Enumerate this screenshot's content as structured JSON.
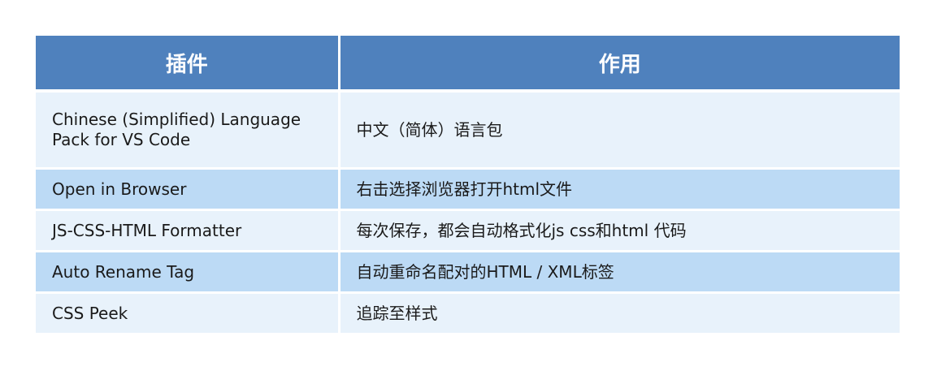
{
  "table": {
    "headers": [
      "插件",
      "作用"
    ],
    "rows": [
      {
        "plugin": "Chinese (Simplified) Language Pack for VS Code",
        "purpose": "中文（简体）语言包"
      },
      {
        "plugin": "Open in Browser",
        "purpose": "右击选择浏览器打开html文件"
      },
      {
        "plugin": "JS-CSS-HTML Formatter",
        "purpose": "每次保存，都会自动格式化js  css和html 代码"
      },
      {
        "plugin": "Auto Rename Tag",
        "purpose": "自动重命名配对的HTML / XML标签"
      },
      {
        "plugin": "CSS Peek",
        "purpose": "追踪至样式"
      }
    ]
  },
  "colors": {
    "header_bg": "#4f81bd",
    "row_light": "#e8f2fb",
    "row_dark": "#bcdaf5"
  }
}
